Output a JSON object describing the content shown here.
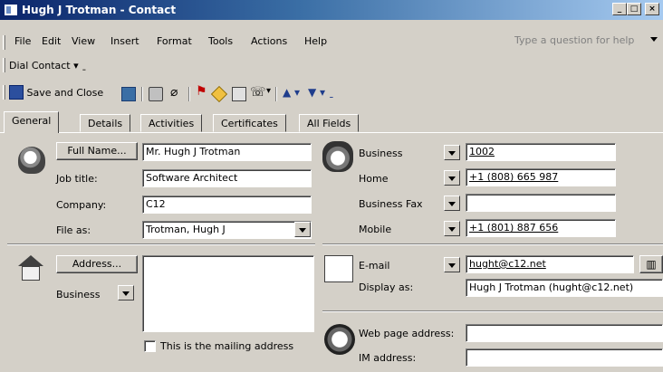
{
  "window": {
    "title": "Hugh J Trotman - Contact",
    "min": "_",
    "max": "□",
    "close": "×"
  },
  "menu": {
    "items": [
      "File",
      "Edit",
      "View",
      "Insert",
      "Format",
      "Tools",
      "Actions",
      "Help"
    ],
    "help_placeholder": "Type a question for help"
  },
  "dial_toolbar": {
    "dial_contact": "Dial Contact"
  },
  "toolbar": {
    "save_close": "Save and Close"
  },
  "tabs": [
    "General",
    "Details",
    "Activities",
    "Certificates",
    "All Fields"
  ],
  "general": {
    "full_name_button": "Full Name...",
    "full_name": "Mr. Hugh J Trotman",
    "job_title_label": "Job title:",
    "job_title": "Software Architect",
    "company_label": "Company:",
    "company": "C12",
    "file_as_label": "File as:",
    "file_as": "Trotman, Hugh J",
    "address_button": "Address...",
    "address_type": "Business",
    "address_value": "",
    "mailing_address_label": "This is the mailing address"
  },
  "phones": [
    {
      "label": "Business",
      "value": "1002"
    },
    {
      "label": "Home",
      "value": "+1 (808) 665 987"
    },
    {
      "label": "Business Fax",
      "value": ""
    },
    {
      "label": "Mobile",
      "value": "+1 (801) 887 656"
    }
  ],
  "email": {
    "label": "E-mail",
    "value": "hught@c12.net",
    "display_as_label": "Display as:",
    "display_as": "Hugh J Trotman (hught@c12.net)"
  },
  "web": {
    "label": "Web page address:",
    "value": "",
    "im_label": "IM address:",
    "im_value": ""
  }
}
